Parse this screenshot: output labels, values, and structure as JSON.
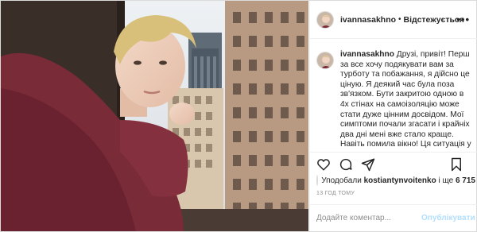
{
  "post": {
    "username": "ivannasakhno",
    "separator": "•",
    "follow_status": "Відстежується",
    "more_icon": "more-horizontal-icon"
  },
  "caption": {
    "username": "ivannasakhno",
    "text": "Друзі, привіт! Перш за все хочу подякувати вам за турботу та побажання, я дійсно це ціную. Я деякий час була поза зв'язком. Бути закритою одною в 4х стінах на самоізоляцію може стати дуже цінним досвідом. Мої симптоми почали згасати і крайніх два дні мені вже стало краще. Навіть помила вікно! Ця ситуація у світі торкнулась кожного з"
  },
  "actions": {
    "like_icon": "heart-icon",
    "comment_icon": "comment-icon",
    "share_icon": "share-icon",
    "save_icon": "bookmark-icon"
  },
  "likes": {
    "prefix": "Уподобали",
    "user": "kostiantynvoitenko",
    "middle": "і ще",
    "count": "6 715"
  },
  "timestamp": "13 год тому",
  "comment_box": {
    "placeholder": "Додайте коментар...",
    "submit_label": "Опублікувати"
  },
  "colors": {
    "text": "#262626",
    "secondary": "#8e8e8e",
    "border": "#dbdbdb",
    "publish_disabled": "#b2dffc"
  }
}
